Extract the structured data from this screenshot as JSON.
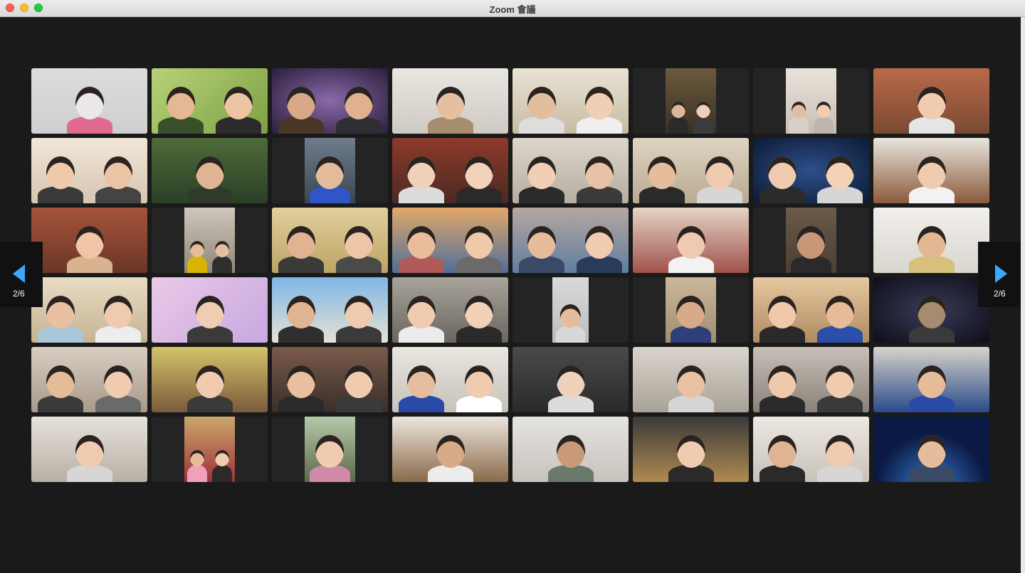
{
  "window": {
    "title": "Zoom 會議"
  },
  "pagination": {
    "label": "2/6",
    "arrow_color": "#3ea6ff"
  },
  "participants": [
    {
      "bg": "linear-gradient(#dcdcdc,#cfcfcf)",
      "people": [
        [
          "#e06b8e",
          "#ece8ea"
        ]
      ]
    },
    {
      "bg": "linear-gradient(135deg,#b7d27a,#7ea043)",
      "people": [
        [
          "#3a4f2c",
          "#e5b894"
        ],
        [
          "#2b2b2b",
          "#edc5a4"
        ]
      ]
    },
    {
      "bg": "radial-gradient(#8a6aa8,#2a1e3c)",
      "people": [
        [
          "#4a3626",
          "#d8a988"
        ],
        [
          "#2e2e33",
          "#e0b190"
        ]
      ]
    },
    {
      "bg": "linear-gradient(#e9e6e0,#cfcac3)",
      "people": [
        [
          "#a78d6f",
          "#e6bfa0"
        ]
      ]
    },
    {
      "bg": "linear-gradient(#e9e3d4,#c7bba4)",
      "people": [
        [
          "#dedede",
          "#e3bd9f"
        ],
        [
          "#efefef",
          "#f0cfb4"
        ]
      ]
    },
    {
      "bg": "linear-gradient(#6b5a3e,#3b2f22)",
      "narrow": true,
      "people": [
        [
          "#2a2a2a",
          "#e0b69a"
        ],
        [
          "#3b3b3b",
          "#f0d0b8"
        ]
      ]
    },
    {
      "bg": "linear-gradient(#e8e2da,#c8bfb3)",
      "narrow": true,
      "people": [
        [
          "#d8d0c8",
          "#e4bda0"
        ],
        [
          "#bfb6ad",
          "#f0cdb1"
        ]
      ]
    },
    {
      "bg": "linear-gradient(#b9694a,#7a4a33)",
      "people": [
        [
          "#e5e5e5",
          "#f0cbb0"
        ]
      ]
    },
    {
      "bg": "linear-gradient(#f1e6d8,#d6c6b1)",
      "people": [
        [
          "#3a3a3a",
          "#f0c9ab"
        ],
        [
          "#444",
          "#ebc3a5"
        ]
      ]
    },
    {
      "bg": "linear-gradient(#4f6b3a,#2a3f26)",
      "people": [
        [
          "#2f3a2a",
          "#e0b594"
        ]
      ]
    },
    {
      "bg": "linear-gradient(#6f7d8c,#3a4552)",
      "narrow": true,
      "people": [
        [
          "#2f55c6",
          "#e3bc9c"
        ]
      ]
    },
    {
      "bg": "linear-gradient(#8e3a2a,#4a2a22)",
      "people": [
        [
          "#dcdcdc",
          "#f0d0b8"
        ],
        [
          "#2a2a2a",
          "#f2d2bb"
        ]
      ]
    },
    {
      "bg": "linear-gradient(#dcd6cc,#b5ada2)",
      "people": [
        [
          "#2b2b2b",
          "#f1cfb6"
        ],
        [
          "#3a3a3a",
          "#e9c2a6"
        ]
      ]
    },
    {
      "bg": "linear-gradient(#ded4c2,#b8aa92)",
      "people": [
        [
          "#2a2a2a",
          "#e6bd9c"
        ],
        [
          "#d6d6d6",
          "#f0cbb0"
        ]
      ]
    },
    {
      "bg": "radial-gradient(#2d4f8a,#0c1a33)",
      "people": [
        [
          "#2b2b2b",
          "#f0caae"
        ],
        [
          "#d6d6d6",
          "#f3d2b8"
        ]
      ]
    },
    {
      "bg": "linear-gradient(#e9e5df,#8a5a3a)",
      "people": [
        [
          "#f2f2f2",
          "#f0cbb0"
        ]
      ]
    },
    {
      "bg": "linear-gradient(#a6543a,#6a3626)",
      "people": [
        [
          "#d8b38f",
          "#f0c5a5"
        ]
      ]
    },
    {
      "bg": "linear-gradient(#cfc7bb,#8f8678)",
      "narrow": true,
      "people": [
        [
          "#d6b400",
          "#e6bb98"
        ],
        [
          "#2f2f2f",
          "#e8bf9e"
        ]
      ]
    },
    {
      "bg": "linear-gradient(#e2cf9c,#bda466)",
      "people": [
        [
          "#3a3a3a",
          "#e0b392"
        ],
        [
          "#4a4a4a",
          "#eec5a6"
        ]
      ]
    },
    {
      "bg": "linear-gradient(#e3a869,#4f6f9a)",
      "people": [
        [
          "#b05a5a",
          "#e9bd9b"
        ],
        [
          "#6a6a6a",
          "#f0c8aa"
        ]
      ]
    },
    {
      "bg": "linear-gradient(#b7a6a0,#5f7f9f)",
      "people": [
        [
          "#3a4a66",
          "#e6bc9b"
        ],
        [
          "#2a3a5a",
          "#f0cbb0"
        ]
      ]
    },
    {
      "bg": "linear-gradient(#e6d4c6,#a0524a)",
      "people": [
        [
          "#f2f2f2",
          "#f0cab0"
        ]
      ]
    },
    {
      "bg": "linear-gradient(#6b5a4a,#4a3e33)",
      "narrow": true,
      "people": [
        [
          "#2a2a2a",
          "#c99778"
        ]
      ]
    },
    {
      "bg": "linear-gradient(#f2f0ec,#d9d5cf)",
      "people": [
        [
          "#d6c07a",
          "#e4b793"
        ]
      ]
    },
    {
      "bg": "linear-gradient(#e8dcc4,#c6b392)",
      "people": [
        [
          "#a9c7d9",
          "#e9c0a0"
        ],
        [
          "#ededed",
          "#f0caae"
        ]
      ]
    },
    {
      "bg": "linear-gradient(135deg,#e9c9e6,#c8a8e0)",
      "people": [
        [
          "#3a3a3a",
          "#f0ccb2"
        ]
      ]
    },
    {
      "bg": "linear-gradient(#7fb6e6,#e6e2d4)",
      "people": [
        [
          "#2f2f2f",
          "#e0b593"
        ],
        [
          "#3a3a3a",
          "#f0caae"
        ]
      ]
    },
    {
      "bg": "linear-gradient(#a8a49c,#6a665f)",
      "people": [
        [
          "#ececec",
          "#f0cbb0"
        ],
        [
          "#2a2a2a",
          "#f2d1b8"
        ]
      ]
    },
    {
      "bg": "linear-gradient(#d9d9d9,#bdbdbd)",
      "narrow2": true,
      "people": [
        [
          "#d8d8d8",
          "#e6bd9c"
        ]
      ]
    },
    {
      "bg": "linear-gradient(#cbb89a,#a08d6f)",
      "narrow": true,
      "people": [
        [
          "#2f3f7a",
          "#d9aa87"
        ]
      ]
    },
    {
      "bg": "linear-gradient(#e6c8a0,#b08a60)",
      "people": [
        [
          "#2a2a2a",
          "#f0c8aa"
        ],
        [
          "#2a4fa8",
          "#e6bb97"
        ]
      ]
    },
    {
      "bg": "radial-gradient(#3a3a5a,#0e0e18)",
      "people": [
        [
          "#3a3a3a",
          "#a88a70"
        ]
      ]
    },
    {
      "bg": "linear-gradient(#d8cfc2,#a8998a)",
      "people": [
        [
          "#3a3a3a",
          "#e6bb98"
        ],
        [
          "#6a6a6a",
          "#f0cbb0"
        ]
      ]
    },
    {
      "bg": "linear-gradient(#d6c46a,#7a5a3a)",
      "people": [
        [
          "#3a3a3a",
          "#f0cbb0"
        ]
      ]
    },
    {
      "bg": "linear-gradient(#7a5a4a,#3a2e2a)",
      "people": [
        [
          "#2a2a2a",
          "#e9bf9f"
        ],
        [
          "#3a3a3a",
          "#f0cbb0"
        ]
      ]
    },
    {
      "bg": "linear-gradient(#e9e6e0,#c7c2ba)",
      "people": [
        [
          "#2a4aa8",
          "#e6bd9d"
        ],
        [
          "#ffffff",
          "#f0cbb0"
        ]
      ]
    },
    {
      "bg": "linear-gradient(#4a4a4a,#2a2a2a)",
      "people": [
        [
          "#dcdcdc",
          "#f0d2bc"
        ]
      ]
    },
    {
      "bg": "linear-gradient(#d9d4cc,#a9a298)",
      "people": [
        [
          "#d6d6d6",
          "#e9c2a4"
        ]
      ]
    },
    {
      "bg": "linear-gradient(#c8c0b8,#8a8178)",
      "people": [
        [
          "#2a2a2a",
          "#efc9ac"
        ],
        [
          "#3a3a3a",
          "#f0cbb0"
        ]
      ]
    },
    {
      "bg": "linear-gradient(#d8d4cc,#2a4a8a)",
      "people": [
        [
          "#2a4aa8",
          "#e6bb98"
        ]
      ]
    },
    {
      "bg": "linear-gradient(#e6e2dc,#b7afa4)",
      "people": [
        [
          "#d6d6d6",
          "#f0cbb0"
        ]
      ]
    },
    {
      "bg": "linear-gradient(#c9a86a,#a0303a)",
      "narrow": true,
      "people": [
        [
          "#f0a0b8",
          "#e6bd9c"
        ],
        [
          "#2a2a2a",
          "#f0cbb0"
        ]
      ]
    },
    {
      "bg": "linear-gradient(#b5c9a8,#5a6a4a)",
      "narrow": true,
      "people": [
        [
          "#d08aa8",
          "#f0cbb0"
        ]
      ]
    },
    {
      "bg": "linear-gradient(#ece6dc,#8a6a4a)",
      "people": [
        [
          "#ececec",
          "#d9aa87"
        ]
      ]
    },
    {
      "bg": "linear-gradient(#e6e4e0,#c6c2bc)",
      "people": [
        [
          "#6a7a6a",
          "#c99a7a"
        ]
      ]
    },
    {
      "bg": "linear-gradient(#3a3a3a,#b08a50)",
      "people": [
        [
          "#2a2a2a",
          "#f0cbb0"
        ]
      ]
    },
    {
      "bg": "linear-gradient(#ece8e2,#c8c2b9)",
      "people": [
        [
          "#2a2a2a",
          "#e0b392"
        ],
        [
          "#d6d6d6",
          "#f0cbb0"
        ]
      ]
    },
    {
      "bg": "radial-gradient(circle at 50% 110%,#3a7ad0,#0a1a44 60%)",
      "people": [
        [
          "#3a4a66",
          "#e6bd9c"
        ]
      ]
    }
  ]
}
